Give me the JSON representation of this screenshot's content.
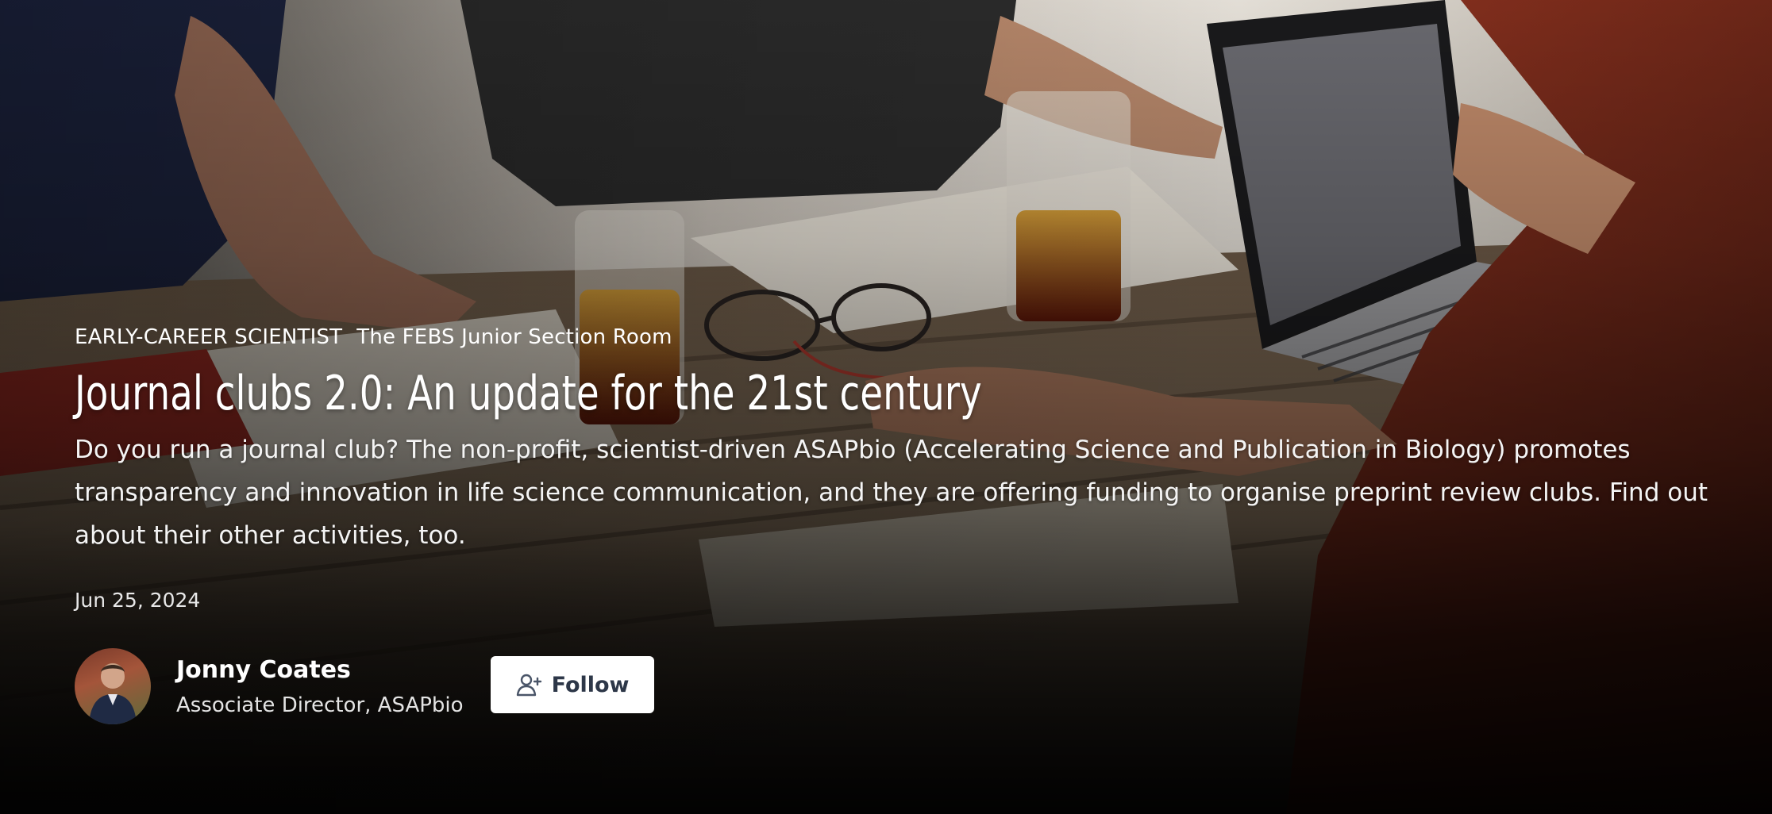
{
  "article": {
    "section": "EARLY-CAREER SCIENTIST",
    "column": "The FEBS Junior Section Room",
    "title": "Journal clubs 2.0: An update for the 21st century",
    "summary": "Do you run a journal club? The non-profit, scientist-driven ASAPbio (Accelerating Science and Publication in Biology) promotes transparency and innovation in life science communication, and they are offering funding to organise preprint review clubs. Find out about their other activities, too.",
    "date": "Jun 25, 2024"
  },
  "author": {
    "name": "Jonny Coates",
    "role": "Associate Director, ASAPbio",
    "avatar_icon": "author-avatar"
  },
  "actions": {
    "follow_label": "Follow",
    "follow_icon": "user-plus-icon"
  },
  "colors": {
    "button_bg": "#ffffff",
    "button_text": "#2d3748",
    "text_primary": "#ffffff"
  }
}
